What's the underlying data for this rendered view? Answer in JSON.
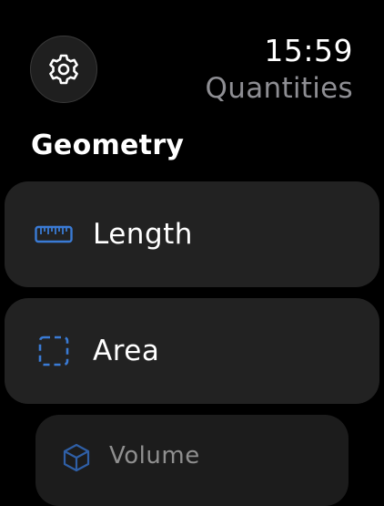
{
  "header": {
    "time": "15:59",
    "app_title": "Quantities",
    "settings_icon": "gear-icon"
  },
  "section": {
    "title": "Geometry"
  },
  "items": [
    {
      "label": "Length",
      "icon": "ruler-icon"
    },
    {
      "label": "Area",
      "icon": "dashed-square-icon"
    },
    {
      "label": "Volume",
      "icon": "cube-icon"
    }
  ],
  "colors": {
    "accent": "#3a7bd5",
    "card_background": "#222222",
    "secondary_text": "#8e8e93"
  }
}
